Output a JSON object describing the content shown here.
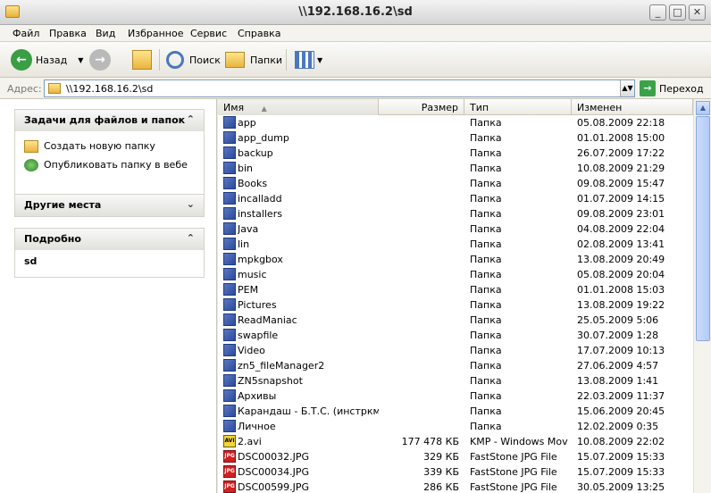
{
  "window": {
    "title": "\\\\192.168.16.2\\sd",
    "minimize_label": "_",
    "maximize_label": "□",
    "close_label": "✕"
  },
  "menu": [
    "Файл",
    "Правка",
    "Вид",
    "Избранное",
    "Сервис",
    "Справка"
  ],
  "toolbar": {
    "back_label": "Назад",
    "search_label": "Поиск",
    "folders_label": "Папки"
  },
  "address": {
    "label": "Адрес:",
    "value": "\\\\192.168.16.2\\sd",
    "go_label": "Переход"
  },
  "left_pane": {
    "tasks": {
      "title": "Задачи для файлов и папок",
      "items": [
        "Создать новую папку",
        "Опубликовать папку в вебе"
      ]
    },
    "other_places": {
      "title": "Другие места"
    },
    "details": {
      "title": "Подробно",
      "name": "sd"
    }
  },
  "columns": {
    "name": "Имя",
    "size": "Размер",
    "type": "Тип",
    "modified": "Изменен"
  },
  "files": [
    {
      "name": "app",
      "size": "",
      "type": "Папка",
      "modified": "05.08.2009 22:18",
      "icon": "folder"
    },
    {
      "name": "app_dump",
      "size": "",
      "type": "Папка",
      "modified": "01.01.2008 15:00",
      "icon": "folder"
    },
    {
      "name": "backup",
      "size": "",
      "type": "Папка",
      "modified": "26.07.2009 17:22",
      "icon": "folder"
    },
    {
      "name": "bin",
      "size": "",
      "type": "Папка",
      "modified": "10.08.2009 21:29",
      "icon": "folder"
    },
    {
      "name": "Books",
      "size": "",
      "type": "Папка",
      "modified": "09.08.2009 15:47",
      "icon": "folder"
    },
    {
      "name": "incalladd",
      "size": "",
      "type": "Папка",
      "modified": "01.07.2009 14:15",
      "icon": "folder"
    },
    {
      "name": "installers",
      "size": "",
      "type": "Папка",
      "modified": "09.08.2009 23:01",
      "icon": "folder"
    },
    {
      "name": "Java",
      "size": "",
      "type": "Папка",
      "modified": "04.08.2009 22:04",
      "icon": "folder"
    },
    {
      "name": "lin",
      "size": "",
      "type": "Папка",
      "modified": "02.08.2009 13:41",
      "icon": "folder"
    },
    {
      "name": "mpkgbox",
      "size": "",
      "type": "Папка",
      "modified": "13.08.2009 20:49",
      "icon": "folder"
    },
    {
      "name": "music",
      "size": "",
      "type": "Папка",
      "modified": "05.08.2009 20:04",
      "icon": "folder"
    },
    {
      "name": "PEM",
      "size": "",
      "type": "Папка",
      "modified": "01.01.2008 15:03",
      "icon": "folder"
    },
    {
      "name": "Pictures",
      "size": "",
      "type": "Папка",
      "modified": "13.08.2009 19:22",
      "icon": "folder"
    },
    {
      "name": "ReadManiac",
      "size": "",
      "type": "Папка",
      "modified": "25.05.2009 5:06",
      "icon": "folder"
    },
    {
      "name": "swapfile",
      "size": "",
      "type": "Папка",
      "modified": "30.07.2009 1:28",
      "icon": "folder"
    },
    {
      "name": "Video",
      "size": "",
      "type": "Папка",
      "modified": "17.07.2009 10:13",
      "icon": "folder"
    },
    {
      "name": "zn5_fileManager2",
      "size": "",
      "type": "Папка",
      "modified": "27.06.2009 4:57",
      "icon": "folder"
    },
    {
      "name": "ZN5snapshot",
      "size": "",
      "type": "Папка",
      "modified": "13.08.2009 1:41",
      "icon": "folder"
    },
    {
      "name": "Архивы",
      "size": "",
      "type": "Папка",
      "modified": "22.03.2009 11:37",
      "icon": "folder"
    },
    {
      "name": "Карандаш - Б.Т.С. (инстркм...",
      "size": "",
      "type": "Папка",
      "modified": "15.06.2009 20:45",
      "icon": "folder"
    },
    {
      "name": "Личное",
      "size": "",
      "type": "Папка",
      "modified": "12.02.2009 0:35",
      "icon": "folder"
    },
    {
      "name": "2.avi",
      "size": "177 478 КБ",
      "type": "KMP - Windows Mov...",
      "modified": "10.08.2009 22:02",
      "icon": "avi"
    },
    {
      "name": "DSC00032.JPG",
      "size": "329 КБ",
      "type": "FastStone JPG File",
      "modified": "15.07.2009 15:33",
      "icon": "jpg"
    },
    {
      "name": "DSC00034.JPG",
      "size": "339 КБ",
      "type": "FastStone JPG File",
      "modified": "15.07.2009 15:33",
      "icon": "jpg"
    },
    {
      "name": "DSC00599.JPG",
      "size": "286 КБ",
      "type": "FastStone JPG File",
      "modified": "30.05.2009 13:25",
      "icon": "jpg"
    }
  ]
}
